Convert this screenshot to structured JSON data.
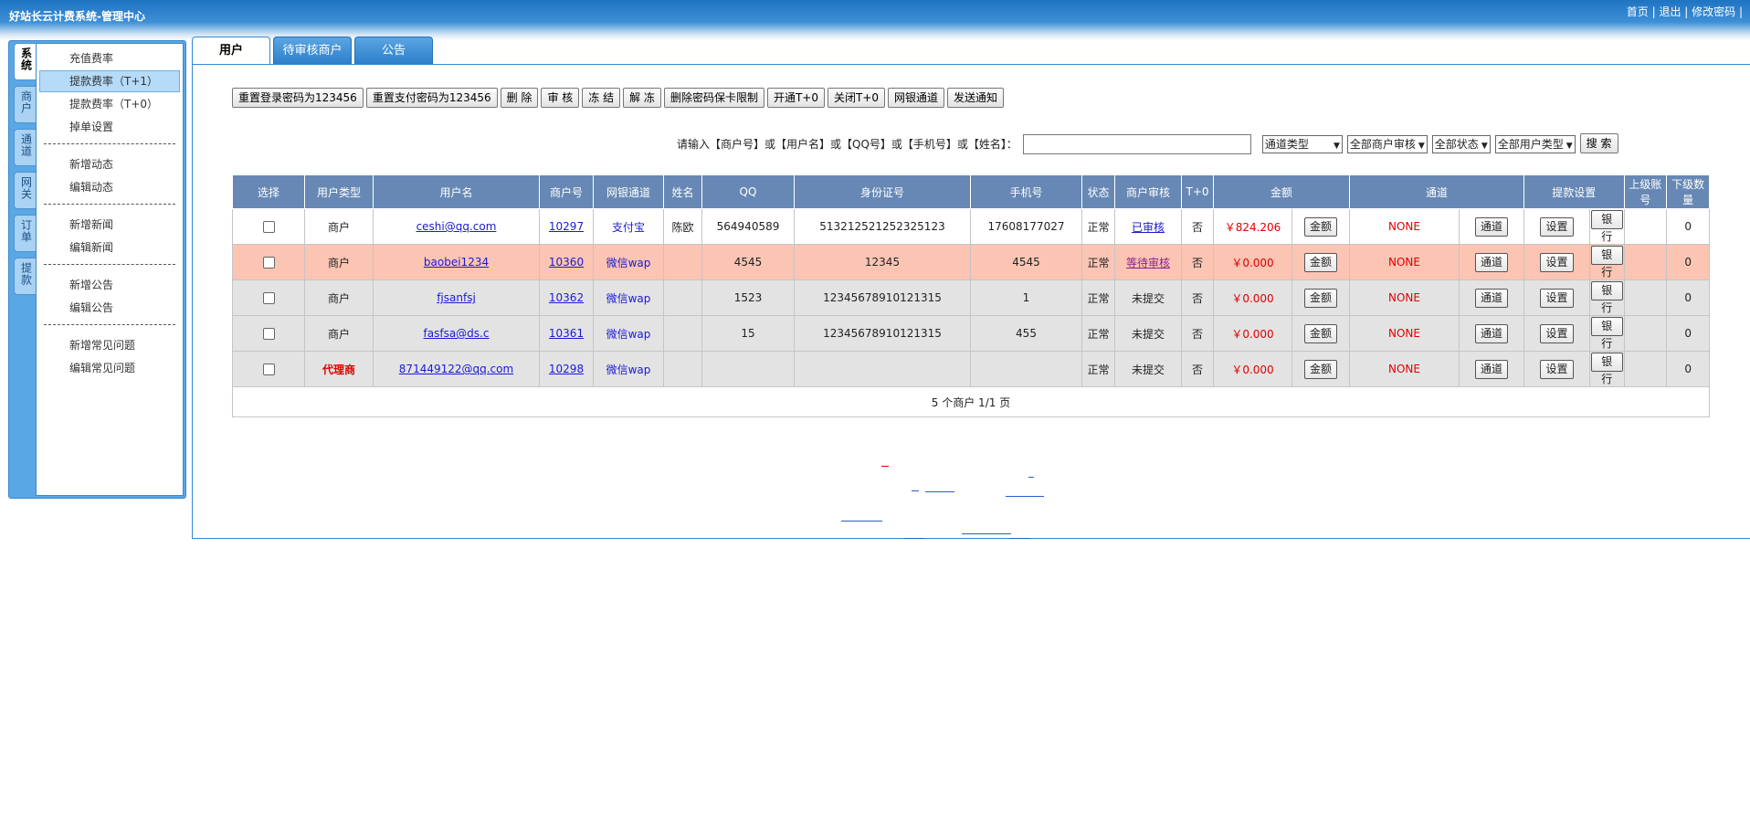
{
  "header": {
    "title": "好站长云计费系统-管理中心",
    "links": [
      "首页",
      "退出",
      "修改密码"
    ]
  },
  "side_tabs": [
    "系统",
    "商户",
    "通道",
    "网关",
    "订单",
    "提款"
  ],
  "menu": {
    "groups": [
      [
        "充值费率",
        "提款费率（T+1）",
        "提款费率（T+0）",
        "掉单设置"
      ],
      [
        "新增动态",
        "编辑动态"
      ],
      [
        "新增新闻",
        "编辑新闻"
      ],
      [
        "新增公告",
        "编辑公告"
      ],
      [
        "新增常见问题",
        "编辑常见问题"
      ]
    ],
    "active": "提款费率（T+1）"
  },
  "tabs": [
    "用户",
    "待审核商户",
    "公告"
  ],
  "toolbar": [
    "重置登录密码为123456",
    "重置支付密码为123456",
    "删 除",
    "审 核",
    "冻 结",
    "解 冻",
    "删除密码保卡限制",
    "开通T+0",
    "关闭T+0",
    "网银通道",
    "发送通知"
  ],
  "search": {
    "label": "请输入【商户号】或【用户名】或【QQ号】或【手机号】或【姓名】：",
    "value": "",
    "selects": [
      "通道类型",
      "全部商户审核",
      "全部状态",
      "全部用户类型"
    ],
    "button": "搜 索"
  },
  "table": {
    "headers": [
      "选择",
      "用户类型",
      "用户名",
      "商户号",
      "网银通道",
      "姓名",
      "QQ",
      "身份证号",
      "手机号",
      "状态",
      "商户审核",
      "T+0",
      "金额",
      "通道",
      "提款设置",
      "上级账号",
      "下级数量"
    ],
    "row_buttons": {
      "amount": "金额",
      "channel": "通道",
      "setting": "设置",
      "bank": "银行"
    },
    "rows": [
      {
        "type": "商户",
        "username": "ceshi@qq.com",
        "merchant_id": "10297",
        "gateway": "支付宝",
        "name": "陈欧",
        "qq": "564940589",
        "id_card": "513212521252325123",
        "phone": "17608177027",
        "status": "正常",
        "audit": "已审核",
        "t0": "否",
        "amount": "￥824.206",
        "channel_value": "NONE",
        "parent": "",
        "children": "0"
      },
      {
        "type": "商户",
        "username": "baobei1234",
        "merchant_id": "10360",
        "gateway": "微信wap",
        "name": "",
        "qq": "4545",
        "id_card": "12345",
        "phone": "4545",
        "status": "正常",
        "audit": "等待审核",
        "t0": "否",
        "amount": "￥0.000",
        "channel_value": "NONE",
        "parent": "",
        "children": "0"
      },
      {
        "type": "商户",
        "username": "fjsanfsj",
        "merchant_id": "10362",
        "gateway": "微信wap",
        "name": "",
        "qq": "1523",
        "id_card": "12345678910121315",
        "phone": "1",
        "status": "正常",
        "audit": "未提交",
        "t0": "否",
        "amount": "￥0.000",
        "channel_value": "NONE",
        "parent": "",
        "children": "0"
      },
      {
        "type": "商户",
        "username": "fasfsa@ds.c",
        "merchant_id": "10361",
        "gateway": "微信wap",
        "name": "",
        "qq": "15",
        "id_card": "12345678910121315",
        "phone": "455",
        "status": "正常",
        "audit": "未提交",
        "t0": "否",
        "amount": "￥0.000",
        "channel_value": "NONE",
        "parent": "",
        "children": "0"
      },
      {
        "type": "代理商",
        "username": "871449122@qq.com",
        "merchant_id": "10298",
        "gateway": "微信wap",
        "name": "",
        "qq": "",
        "id_card": "",
        "phone": "",
        "status": "正常",
        "audit": "未提交",
        "t0": "否",
        "amount": "￥0.000",
        "channel_value": "NONE",
        "parent": "",
        "children": "0"
      }
    ],
    "footer": "5 个商户 1/1 页"
  }
}
